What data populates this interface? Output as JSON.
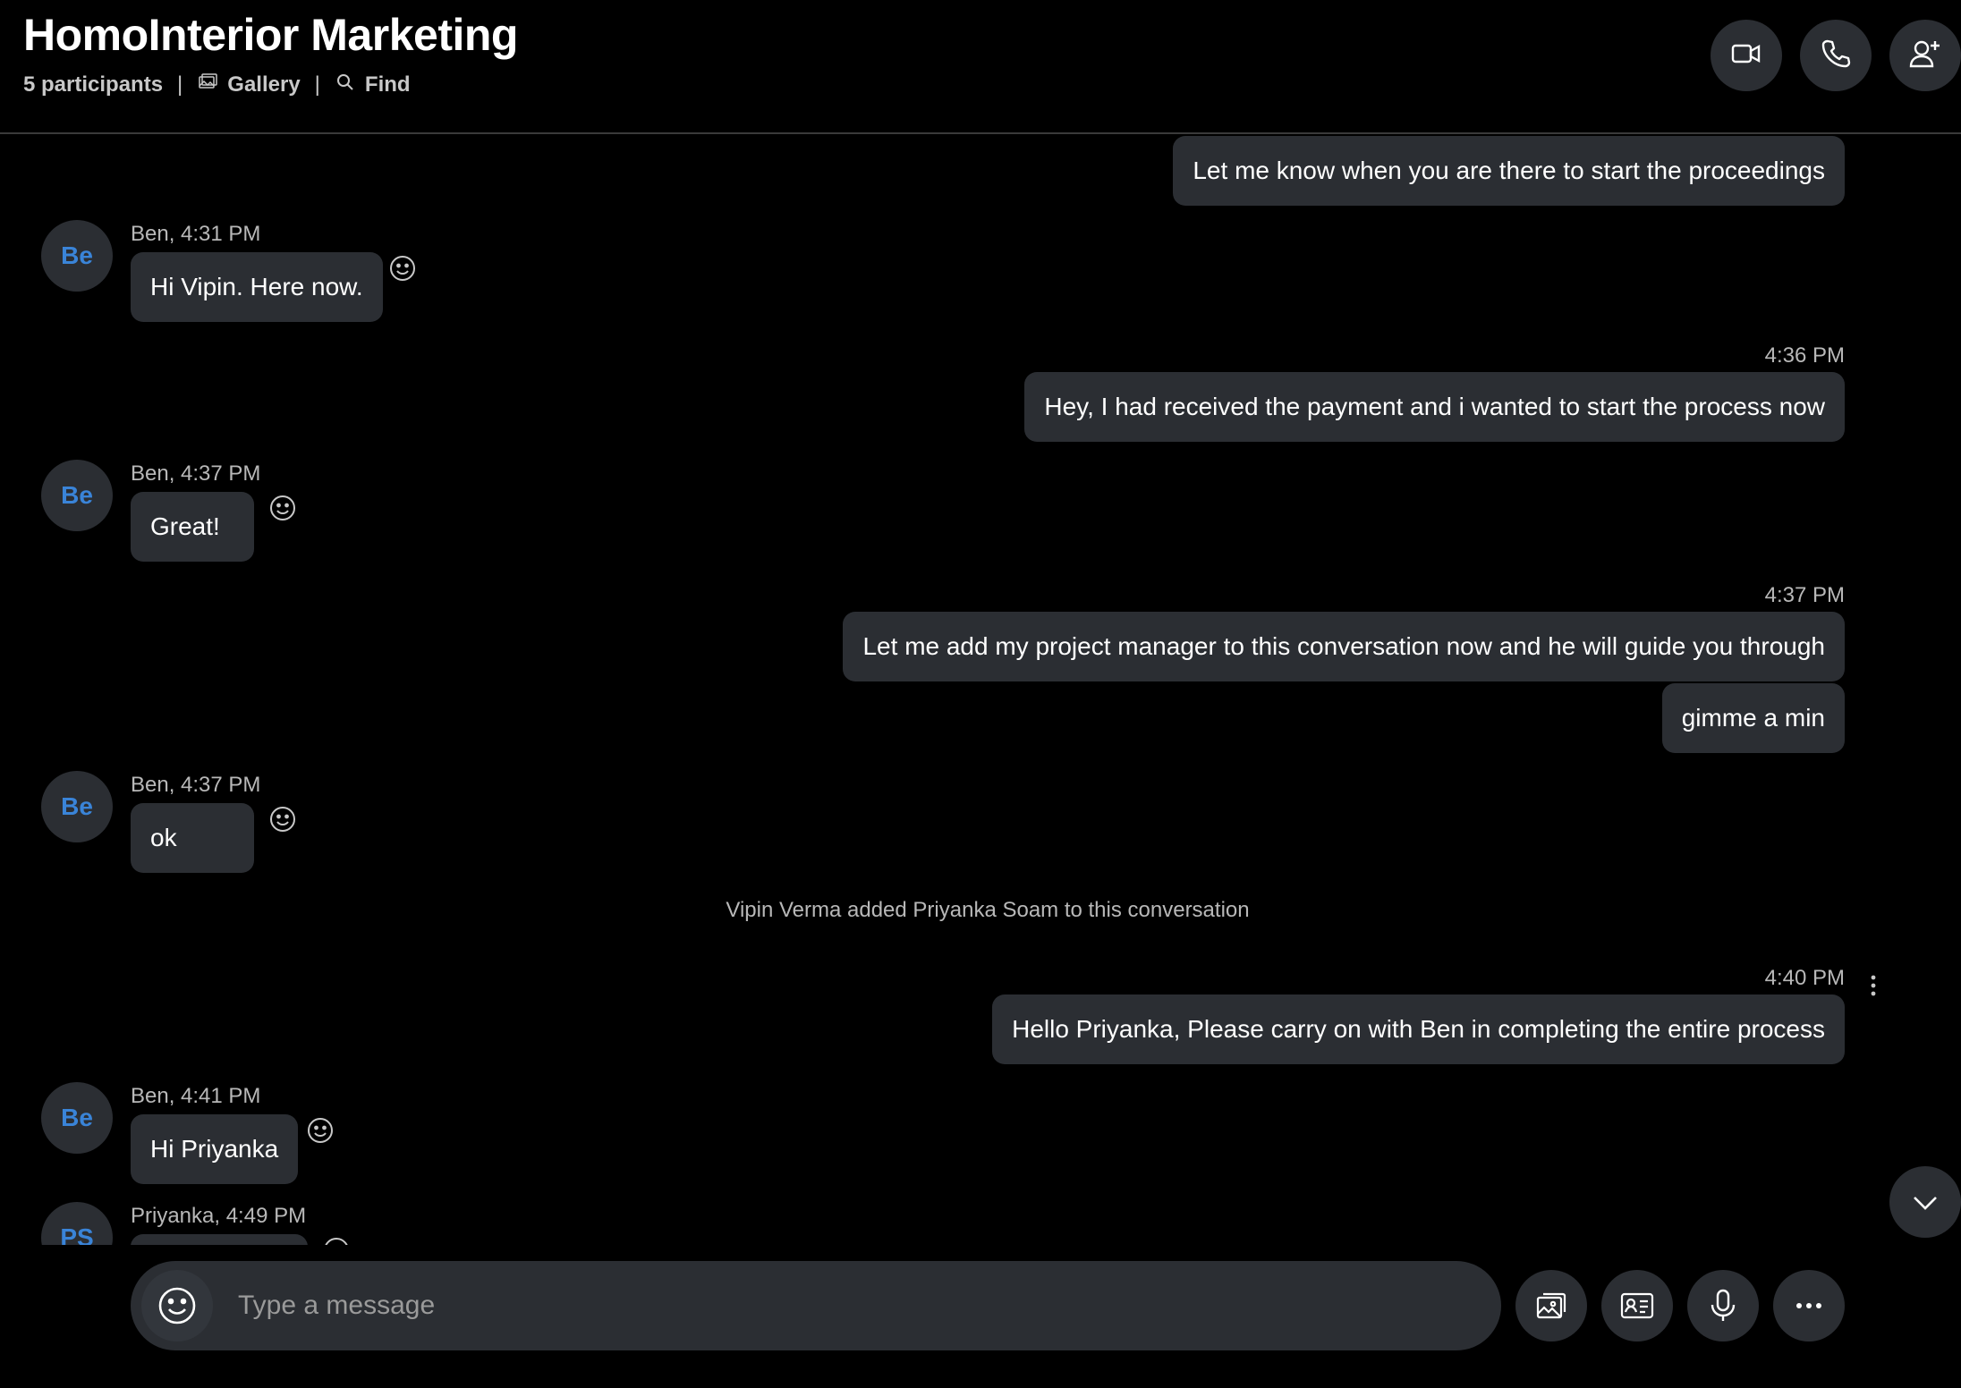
{
  "header": {
    "title": "HomoInterior Marketing",
    "participants": "5 participants",
    "separator": "|",
    "gallery_label": "Gallery",
    "find_label": "Find",
    "buttons": [
      "video-call",
      "audio-call",
      "add-participant"
    ]
  },
  "messages": [
    {
      "type": "outgoing",
      "text": "Let me know when you are there to start the proceedings"
    },
    {
      "type": "incoming",
      "avatar": "Be",
      "meta": "Ben, 4:31 PM",
      "text": "Hi Vipin. Here now."
    },
    {
      "type": "outgoing",
      "meta": "4:36 PM",
      "text": "Hey, I had received the payment and i wanted to start the process now"
    },
    {
      "type": "incoming",
      "avatar": "Be",
      "meta": "Ben, 4:37 PM",
      "text": "Great!"
    },
    {
      "type": "outgoing",
      "meta": "4:37 PM",
      "text": "Let me add my project manager to this conversation now and he will guide you through"
    },
    {
      "type": "outgoing",
      "text": "gimme a min"
    },
    {
      "type": "incoming",
      "avatar": "Be",
      "meta": "Ben, 4:37 PM",
      "text": "ok"
    },
    {
      "type": "system",
      "text": "Vipin Verma added Priyanka Soam to this conversation"
    },
    {
      "type": "outgoing",
      "meta": "4:40 PM",
      "text": "Hello Priyanka, Please carry on with Ben in completing the entire process"
    },
    {
      "type": "incoming",
      "avatar": "Be",
      "meta": "Ben, 4:41 PM",
      "text": "Hi Priyanka"
    },
    {
      "type": "incoming",
      "avatar": "PS",
      "meta": "Priyanka, 4:49 PM",
      "text": ""
    }
  ],
  "composer": {
    "placeholder": "Type a message"
  },
  "colors": {
    "background": "#000000",
    "bubble": "#2b2e33",
    "avatar_text": "#3a84d8",
    "meta_text": "#b8b8b8"
  },
  "icons": [
    "gallery-icon",
    "search-icon",
    "video-camera-icon",
    "phone-icon",
    "add-person-icon",
    "emoji-icon",
    "chevron-down-icon",
    "image-icon",
    "contact-card-icon",
    "microphone-icon",
    "more-horizontal-icon",
    "more-vertical-icon"
  ]
}
